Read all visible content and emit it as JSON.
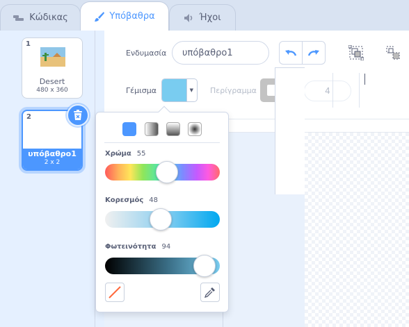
{
  "tabs": [
    {
      "label": "Κώδικας",
      "icon": "code-icon"
    },
    {
      "label": "Υπόβαθρα",
      "icon": "brush-icon"
    },
    {
      "label": "Ήχοι",
      "icon": "speaker-icon"
    }
  ],
  "costumes": [
    {
      "number": "1",
      "name": "Desert",
      "size": "480 x 360"
    },
    {
      "number": "2",
      "name": "υπόβαθρο1",
      "size": "2 x 2"
    }
  ],
  "editor": {
    "costume_label": "Ενδυμασία",
    "costume_name": "υπόβαθρο1",
    "fill_label": "Γέμισμα",
    "outline_label": "Περίγραμμα",
    "stroke_width": "4",
    "fill_color": "#79ccf0"
  },
  "color_picker": {
    "hue_label": "Χρώμα",
    "hue_value": "55",
    "saturation_label": "Κορεσμός",
    "saturation_value": "48",
    "brightness_label": "Φωτεινότητα",
    "brightness_value": "94"
  },
  "colors": {
    "accent": "#4c97ff",
    "text": "#575e75"
  }
}
